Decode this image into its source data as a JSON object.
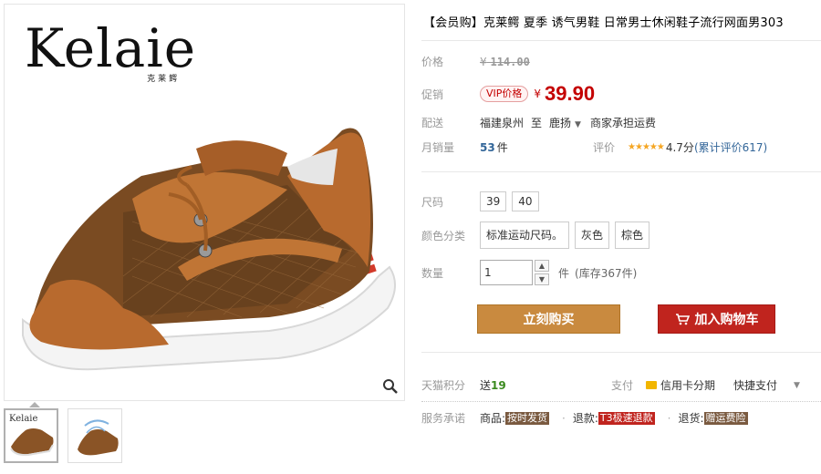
{
  "gallery": {
    "brand_word": "Kelaie",
    "brand_cn": "克莱鳄",
    "thumb_logo": "Kelaie"
  },
  "product": {
    "title": "【会员购】克莱鳄 夏季 诱气男鞋 日常男士休闲鞋子流行网面男303"
  },
  "price": {
    "label": "价格",
    "currency": "¥",
    "original": "114.00"
  },
  "promo": {
    "label": "促销",
    "tag": "VIP价格",
    "currency": "¥",
    "price": "39.90"
  },
  "shipping": {
    "label": "配送",
    "from": "福建泉州",
    "to_label": "至",
    "to": "鹿扬",
    "note": "商家承担运费"
  },
  "sales": {
    "label": "月销量",
    "count": "53",
    "unit": "件",
    "rating_label": "评价",
    "stars": "★★★★★",
    "score": "4.7分",
    "reviews": "(累计评价617)"
  },
  "size": {
    "label": "尺码",
    "options": [
      "39",
      "40"
    ]
  },
  "color": {
    "label": "颜色分类",
    "options": [
      "标准运动尺码。",
      "灰色",
      "棕色"
    ]
  },
  "quantity": {
    "label": "数量",
    "value": "1",
    "unit": "件",
    "stock": "(库存367件)"
  },
  "actions": {
    "buy_now": "立刻购买",
    "add_to_cart": "加入购物车"
  },
  "points": {
    "label": "天猫积分",
    "prefix": "送",
    "value": "19"
  },
  "payment": {
    "label": "支付",
    "credit": "信用卡分期",
    "quick": "快捷支付"
  },
  "service": {
    "label": "服务承诺",
    "items": [
      {
        "prefix": "商品:",
        "tag": "按时发货"
      },
      {
        "prefix": "退款:",
        "tag": "T3极速退款"
      },
      {
        "prefix": "退货:",
        "tag": "赠运费险"
      }
    ]
  },
  "colors": {
    "accent_red": "#c40000",
    "buy_button": "#c98a3f",
    "cart_button": "#c0241e",
    "link_blue": "#336699"
  }
}
